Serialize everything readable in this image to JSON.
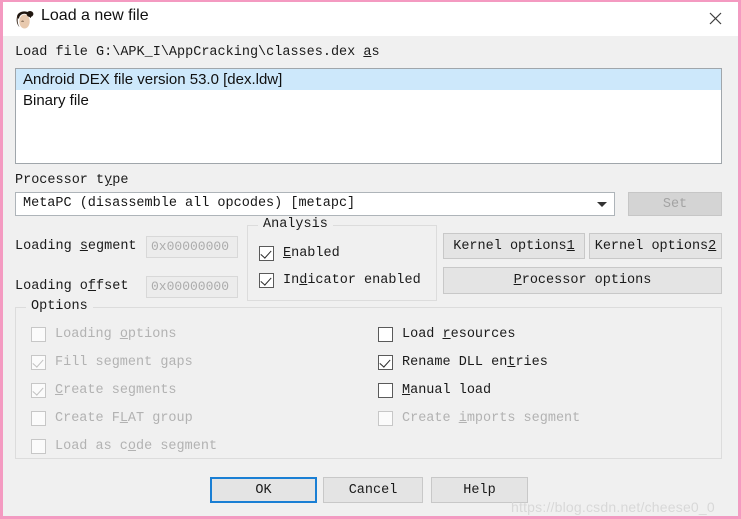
{
  "window": {
    "title": "Load a new file",
    "icon": "ida-woman-icon",
    "close_icon": "close-icon",
    "border_color": "#f49ac1",
    "titlebar_bg": "#ffffff",
    "content_bg": "#f0f0f0"
  },
  "load_file": {
    "prefix": "Load file G:\\APK_I\\AppCracking\\classes.dex ",
    "accel": "a",
    "suffix": "s"
  },
  "loader_list": {
    "items": [
      {
        "label": "Android DEX file version 53.0 [dex.ldw]",
        "selected": true
      },
      {
        "label": "Binary file",
        "selected": false
      }
    ],
    "selection_color": "#cde8fb"
  },
  "processor": {
    "label": "Processor type",
    "label_accel": "y",
    "value": "MetaPC (disassemble all opcodes) [metapc]",
    "arrow_icon": "chevron-down-icon",
    "set_button": {
      "label": "Set",
      "enabled": false
    }
  },
  "loading": {
    "segment_label_pre": "Loading ",
    "segment_accel": "s",
    "segment_label_post": "egment",
    "segment_value": "0x00000000",
    "offset_label_pre": "Loading o",
    "offset_accel": "f",
    "offset_label_post": "fset",
    "offset_value": "0x00000000"
  },
  "analysis": {
    "title": "Analysis",
    "items": [
      {
        "label": "Enabled",
        "accel": "E",
        "checked": true,
        "enabled": true
      },
      {
        "label": "Indicator enabled",
        "accel": "d",
        "checked": true,
        "enabled": true
      }
    ]
  },
  "kernel_buttons": {
    "kernel1": "Kernel options 1",
    "kernel1_accel": "1",
    "kernel2": "Kernel options 2",
    "kernel2_accel": "2",
    "processor_options": "Processor options",
    "processor_options_accel": "P"
  },
  "options": {
    "title": "Options",
    "left": [
      {
        "label": "Loading options",
        "accel": "o",
        "checked": false,
        "enabled": false
      },
      {
        "label": "Fill segment gaps",
        "accel": "g",
        "checked": true,
        "enabled": false
      },
      {
        "label": "Create segments",
        "accel": "C",
        "checked": true,
        "enabled": false
      },
      {
        "label": "Create FLAT group",
        "accel": "L",
        "checked": false,
        "enabled": false
      },
      {
        "label": "Load as code segment",
        "accel": "o",
        "checked": false,
        "enabled": false
      }
    ],
    "right": [
      {
        "label": "Load resources",
        "accel": "r",
        "checked": false,
        "enabled": true
      },
      {
        "label": "Rename DLL entries",
        "accel": "t",
        "checked": true,
        "enabled": true
      },
      {
        "label": "Manual load",
        "accel": "M",
        "checked": false,
        "enabled": true
      },
      {
        "label": "Create imports segment",
        "accel": "i",
        "checked": false,
        "enabled": false
      }
    ]
  },
  "footer": {
    "ok": "OK",
    "cancel": "Cancel",
    "help": "Help",
    "focus_color": "#1a7fd4"
  },
  "watermark": "https://blog.csdn.net/cheese0_0"
}
